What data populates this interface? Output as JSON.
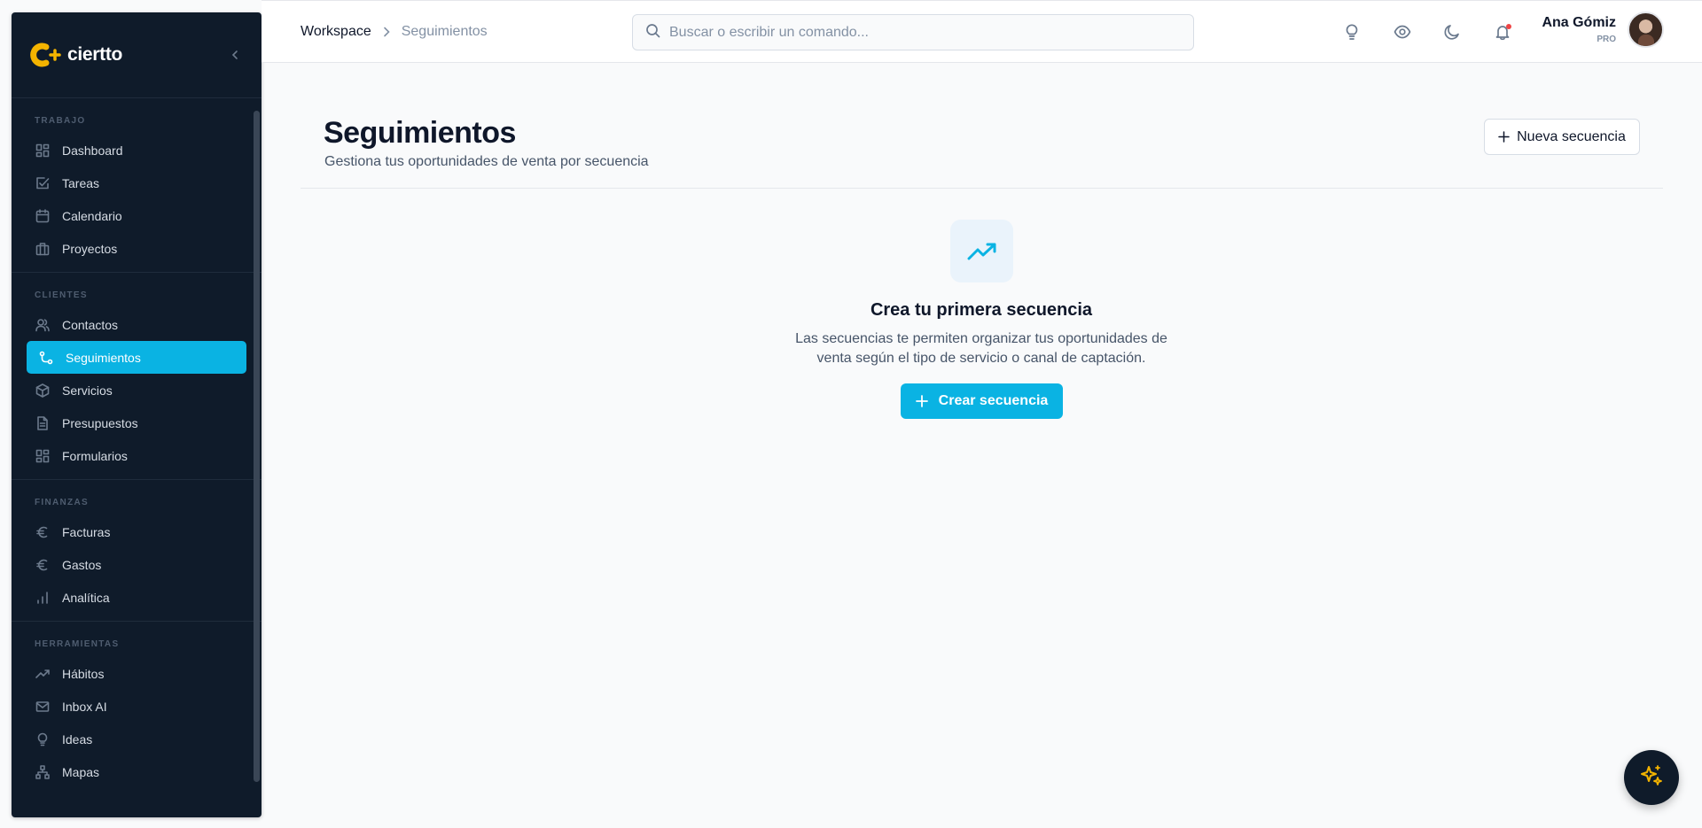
{
  "brand": {
    "name": "ciertto",
    "accent": "#0ab3e3",
    "logo_color": "#f4b400"
  },
  "sidebar": {
    "sections": [
      {
        "label": "TRABAJO",
        "items": [
          {
            "label": "Dashboard",
            "icon": "grid-icon"
          },
          {
            "label": "Tareas",
            "icon": "check-square-icon"
          },
          {
            "label": "Calendario",
            "icon": "calendar-icon"
          },
          {
            "label": "Proyectos",
            "icon": "briefcase-icon"
          }
        ]
      },
      {
        "label": "CLIENTES",
        "items": [
          {
            "label": "Contactos",
            "icon": "users-icon"
          },
          {
            "label": "Seguimientos",
            "icon": "route-icon",
            "active": true
          },
          {
            "label": "Servicios",
            "icon": "box-icon"
          },
          {
            "label": "Presupuestos",
            "icon": "file-text-icon"
          },
          {
            "label": "Formularios",
            "icon": "grid-icon"
          }
        ]
      },
      {
        "label": "FINANZAS",
        "items": [
          {
            "label": "Facturas",
            "icon": "euro-icon"
          },
          {
            "label": "Gastos",
            "icon": "euro-icon"
          },
          {
            "label": "Analítica",
            "icon": "bar-chart-icon"
          }
        ]
      },
      {
        "label": "HERRAMIENTAS",
        "items": [
          {
            "label": "Hábitos",
            "icon": "trending-up-icon"
          },
          {
            "label": "Inbox AI",
            "icon": "mail-icon"
          },
          {
            "label": "Ideas",
            "icon": "lightbulb-icon"
          },
          {
            "label": "Mapas",
            "icon": "sitemap-icon"
          }
        ]
      }
    ]
  },
  "header": {
    "breadcrumb_root": "Workspace",
    "breadcrumb_current": "Seguimientos",
    "search_placeholder": "Buscar o escribir un comando...",
    "user_name": "Ana Gómiz",
    "user_plan": "PRO"
  },
  "main": {
    "title": "Seguimientos",
    "subtitle": "Gestiona tus oportunidades de venta por secuencia",
    "new_button": "Nueva secuencia",
    "empty_title": "Crea tu primera secuencia",
    "empty_text": "Las secuencias te permiten organizar tus oportunidades de venta según el tipo de servicio o canal de captación.",
    "create_button": "Crear secuencia"
  }
}
